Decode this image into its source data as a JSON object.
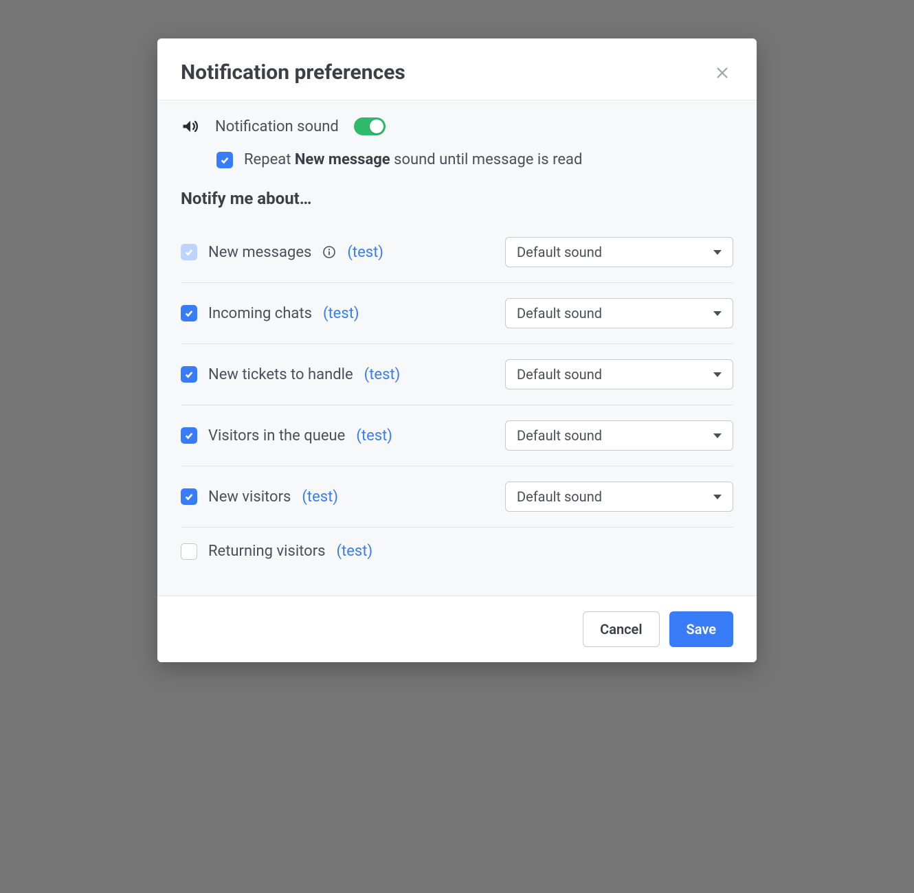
{
  "modal": {
    "title": "Notification preferences",
    "sound_toggle_label": "Notification sound",
    "sound_toggle_on": true,
    "repeat": {
      "checked": true,
      "text_pre": "Repeat ",
      "text_bold": "New message",
      "text_post": " sound until message is read"
    },
    "section_heading": "Notify me about…",
    "default_sound_label": "Default sound",
    "test_label": "(test)",
    "items": [
      {
        "label": "New messages",
        "checked": true,
        "disabled": true,
        "info": true,
        "has_select": true
      },
      {
        "label": "Incoming chats",
        "checked": true,
        "disabled": false,
        "info": false,
        "has_select": true
      },
      {
        "label": "New tickets to handle",
        "checked": true,
        "disabled": false,
        "info": false,
        "has_select": true
      },
      {
        "label": "Visitors in the queue",
        "checked": true,
        "disabled": false,
        "info": false,
        "has_select": true
      },
      {
        "label": "New visitors",
        "checked": true,
        "disabled": false,
        "info": false,
        "has_select": true
      },
      {
        "label": "Returning visitors",
        "checked": false,
        "disabled": false,
        "info": false,
        "has_select": false
      }
    ],
    "footer": {
      "cancel": "Cancel",
      "save": "Save"
    }
  }
}
